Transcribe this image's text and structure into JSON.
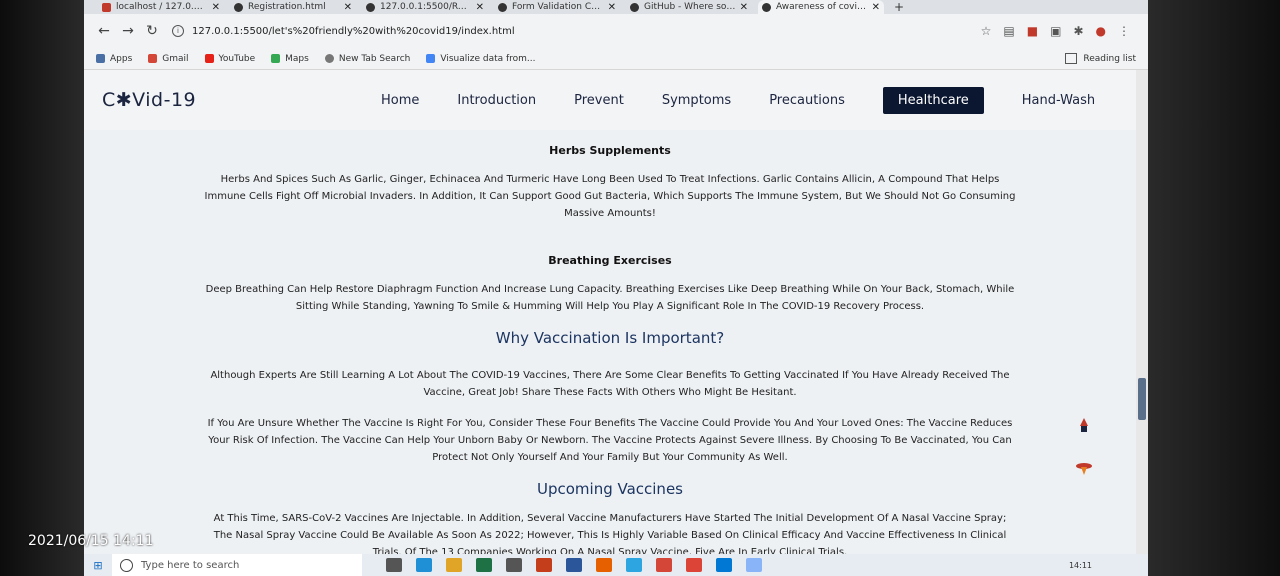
{
  "browser": {
    "tabs": [
      {
        "title": "localhost / 127.0.0.1 /",
        "icon": "database-icon"
      },
      {
        "title": "Registration.html",
        "icon": "globe-icon"
      },
      {
        "title": "127.0.0.1:5500/Registr",
        "icon": "globe-icon"
      },
      {
        "title": "Form Validation Contr",
        "icon": "globe-icon"
      },
      {
        "title": "GitHub - Where softw",
        "icon": "github-icon"
      },
      {
        "title": "Awareness of covid-19",
        "icon": "globe-icon"
      }
    ],
    "url": "127.0.0.1:5500/let's%20friendly%20with%20covid19/index.html",
    "bookmarks": [
      "Apps",
      "Gmail",
      "YouTube",
      "Maps",
      "New Tab Search",
      "Visualize data from..."
    ],
    "reading_list": "Reading list"
  },
  "site": {
    "logo": "C✱Vid-19",
    "nav": [
      "Home",
      "Introduction",
      "Prevent",
      "Symptoms",
      "Precautions",
      "Healthcare",
      "Hand-Wash"
    ],
    "active_nav": "Healthcare"
  },
  "content": {
    "herbs_title": "Herbs Supplements",
    "herbs_text": "Herbs And Spices Such As Garlic, Ginger, Echinacea And Turmeric Have Long Been Used To Treat Infections. Garlic Contains Allicin, A Compound That Helps Immune Cells Fight Off Microbial Invaders. In Addition, It Can Support Good Gut Bacteria, Which Supports The Immune System, But We Should Not Go Consuming Massive Amounts!",
    "breathing_title": "Breathing Exercises",
    "breathing_text": "Deep Breathing Can Help Restore Diaphragm Function And Increase Lung Capacity. Breathing Exercises Like Deep Breathing While On Your Back, Stomach, While Sitting While Standing, Yawning To Smile & Humming Will Help You Play A Significant Role In The COVID-19 Recovery Process.",
    "vaccination_heading": "Why Vaccination Is Important?",
    "vaccination_text1": "Although Experts Are Still Learning A Lot About The COVID-19 Vaccines, There Are Some Clear Benefits To Getting Vaccinated If You Have Already Received The Vaccine, Great Job! Share These Facts With Others Who Might Be Hesitant.",
    "vaccination_text2": "If You Are Unsure Whether The Vaccine Is Right For You, Consider These Four Benefits The Vaccine Could Provide You And Your Loved Ones: The Vaccine Reduces Your Risk Of Infection. The Vaccine Can Help Your Unborn Baby Or Newborn. The Vaccine Protects Against Severe Illness. By Choosing To Be Vaccinated, You Can Protect Not Only Yourself And Your Family But Your Community As Well.",
    "upcoming_heading": "Upcoming Vaccines",
    "upcoming_text": "At This Time, SARS-CoV-2 Vaccines Are Injectable. In Addition, Several Vaccine Manufacturers Have Started The Initial Development Of A Nasal Vaccine Spray; The Nasal Spray Vaccine Could Be Available As Soon As 2022; However, This Is Highly Variable Based On Clinical Efficacy And Vaccine Effectiveness In Clinical Trials. Of The 13 Companies Working On A Nasal Spray Vaccine, Five Are In Early Clinical Trials."
  },
  "taskbar": {
    "search_placeholder": "Type here to search",
    "clock": "14:11"
  },
  "photo_timestamp": "2021/06/15 14:11",
  "colors": {
    "accent": "#0b1730",
    "heading": "#1c3561"
  }
}
